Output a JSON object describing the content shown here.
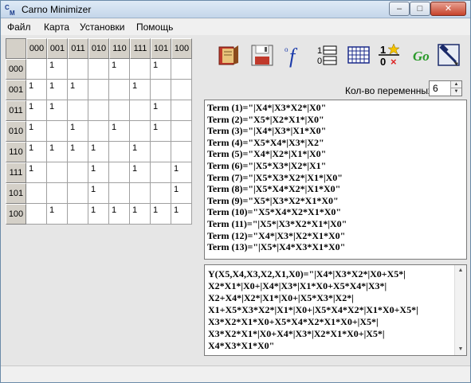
{
  "window": {
    "title": "Carno Minimizer",
    "icon_text": "CM"
  },
  "title_buttons": {
    "minimize": "–",
    "maximize": "□",
    "close": "✕"
  },
  "menu": [
    "Файл",
    "Карта",
    "Установки",
    "Помощь"
  ],
  "kmap": {
    "col_headers": [
      "000",
      "001",
      "011",
      "010",
      "110",
      "111",
      "101",
      "100"
    ],
    "rows": [
      {
        "header": "000",
        "cells": [
          "",
          "1",
          "",
          "",
          "1",
          "",
          "1",
          ""
        ]
      },
      {
        "header": "001",
        "cells": [
          "1",
          "1",
          "1",
          "",
          "",
          "1",
          "",
          ""
        ]
      },
      {
        "header": "011",
        "cells": [
          "1",
          "1",
          "",
          "",
          "",
          "",
          "1",
          ""
        ]
      },
      {
        "header": "010",
        "cells": [
          "1",
          "",
          "1",
          "",
          "1",
          "",
          "1",
          ""
        ]
      },
      {
        "header": "110",
        "cells": [
          "1",
          "1",
          "1",
          "1",
          "",
          "1",
          "",
          ""
        ]
      },
      {
        "header": "111",
        "cells": [
          "1",
          "",
          "",
          "1",
          "",
          "1",
          "",
          "1"
        ]
      },
      {
        "header": "101",
        "cells": [
          "",
          "",
          "",
          "1",
          "",
          "",
          "",
          "1"
        ]
      },
      {
        "header": "100",
        "cells": [
          "",
          "1",
          "",
          "1",
          "1",
          "1",
          "1",
          "1"
        ]
      }
    ]
  },
  "toolbar": {
    "icons": [
      "open-book-icon",
      "save-disk-icon",
      "function-icon",
      "list-10-icon",
      "grid-table-icon",
      "truth-table-icon",
      "go-icon",
      "exit-icon"
    ],
    "function_glyph": "°f",
    "list_glyph": "1☰\n0☰",
    "go_label": "Go"
  },
  "variables": {
    "label": "Кол-во переменных",
    "value": "6"
  },
  "terms": [
    "Term (1)=\"|X4*|X3*X2*|X0\"",
    "Term (2)=\"X5*|X2*X1*|X0\"",
    "Term (3)=\"|X4*|X3*|X1*X0\"",
    "Term (4)=\"X5*X4*|X3*|X2\"",
    "Term (5)=\"X4*|X2*|X1*|X0\"",
    "Term (6)=\"|X5*X3*|X2*|X1\"",
    "Term (7)=\"|X5*X3*X2*|X1*|X0\"",
    "Term (8)=\"|X5*X4*X2*|X1*X0\"",
    "Term (9)=\"X5*|X3*X2*X1*X0\"",
    "Term (10)=\"X5*X4*X2*X1*X0\"",
    "Term (11)=\"|X5*|X3*X2*X1*|X0\"",
    "Term (12)=\"X4*|X3*|X2*X1*X0\"",
    "Term (13)=\"|X5*|X4*X3*X1*X0\""
  ],
  "result": "Y(X5,X4,X3,X2,X1,X0)=\"|X4*|X3*X2*|X0+X5*|\nX2*X1*|X0+|X4*|X3*|X1*X0+X5*X4*|X3*|\nX2+X4*|X2*|X1*|X0+|X5*X3*|X2*|\nX1+X5*X3*X2*|X1*|X0+|X5*X4*X2*|X1*X0+X5*|\nX3*X2*X1*X0+X5*X4*X2*X1*X0+|X5*|\nX3*X2*X1*|X0+X4*|X3*|X2*X1*X0+|X5*|\nX4*X3*X1*X0\""
}
